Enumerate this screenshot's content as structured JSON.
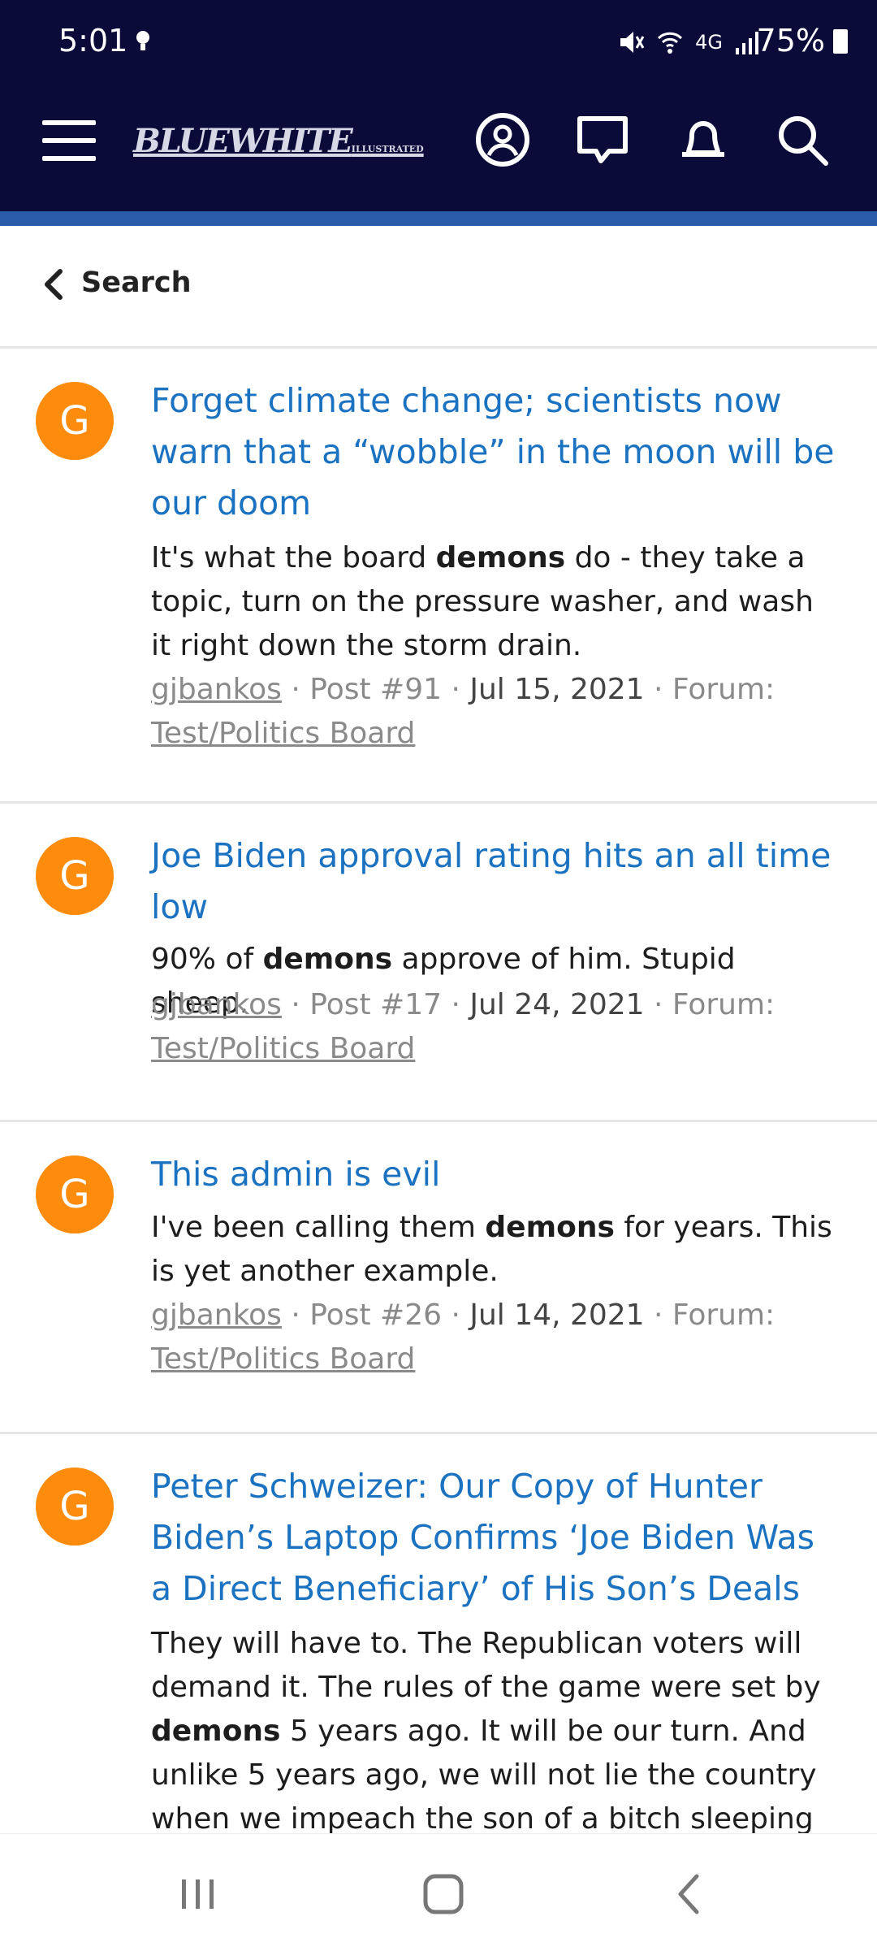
{
  "status_bar": {
    "time": "5:01",
    "battery": "75%",
    "network": "4G"
  },
  "header": {
    "logo_text": "BLUEWHITE",
    "logo_small": "ILLUSTRATED",
    "icons": [
      "menu-icon",
      "account-icon",
      "messages-icon",
      "alerts-icon",
      "search-icon"
    ]
  },
  "back": {
    "label": "Search"
  },
  "results": [
    {
      "avatar": "G",
      "title": "Forget climate change; scientists now warn that a “wobble” in the moon will be our doom",
      "snippet_pre": "It's what the board ",
      "snippet_bold": "demons",
      "snippet_post": " do - they take a topic, turn on the pressure washer, and wash it right down the storm drain.",
      "author": "gjbankos",
      "post": "Post #91",
      "date": "Jul 15, 2021",
      "forum_label": "Forum:",
      "forum": "Test/Politics Board"
    },
    {
      "avatar": "G",
      "title": "Joe Biden approval rating hits an all time low",
      "snippet_pre": "90% of ",
      "snippet_bold": "demons",
      "snippet_post": " approve of him. Stupid sheep.",
      "author": "gjbankos",
      "post": "Post #17",
      "date": "Jul 24, 2021",
      "forum_label": "Forum:",
      "forum": "Test/Politics Board"
    },
    {
      "avatar": "G",
      "title": "This admin is evil",
      "snippet_pre": "I've been calling them ",
      "snippet_bold": "demons",
      "snippet_post": " for years. This is yet another example.",
      "author": "gjbankos",
      "post": "Post #26",
      "date": "Jul 14, 2021",
      "forum_label": "Forum:",
      "forum": "Test/Politics Board"
    },
    {
      "avatar": "G",
      "title": "Peter Schweizer: Our Copy of Hunter Biden’s Laptop Confirms ‘Joe Biden Was a Direct Beneficiary’ of His Son’s Deals",
      "snippet_pre": "They will have to. The Republican voters will demand it. The rules of the game were set by ",
      "snippet_bold": "demons",
      "snippet_post": " 5 years ago. It will be our turn. And unlike 5 years ago, we will not lie the country when we impeach the son of a bitch sleeping in"
    }
  ],
  "colors": {
    "header": "#0a0b38",
    "stripe": "#2a5caa",
    "link": "#1b72c0",
    "avatar": "#fd8c0d"
  }
}
